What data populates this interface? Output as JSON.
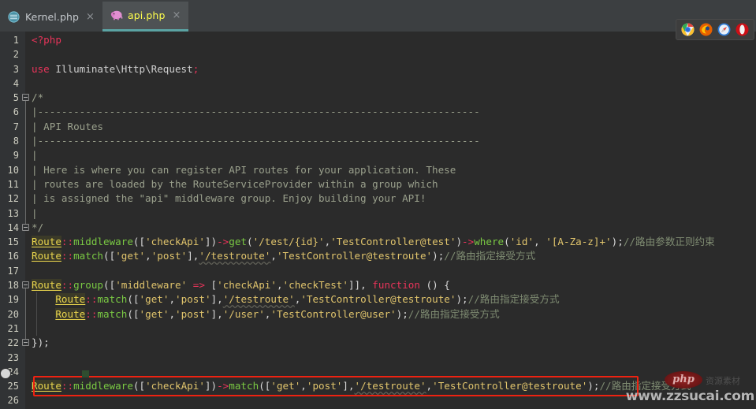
{
  "window": {
    "app": "PhpStorm Editor",
    "background_color": "#2b2b2b"
  },
  "tabs": [
    {
      "label": "Kernel.php",
      "icon": "php-file-icon",
      "close_label": "×",
      "active": false
    },
    {
      "label": "api.php",
      "icon": "php-elephant-icon",
      "close_label": "×",
      "active": true
    }
  ],
  "gutter": {
    "line_numbers": [
      "1",
      "2",
      "3",
      "4",
      "5",
      "6",
      "7",
      "8",
      "9",
      "10",
      "11",
      "12",
      "13",
      "14",
      "15",
      "16",
      "17",
      "18",
      "19",
      "20",
      "21",
      "22",
      "23",
      "24",
      "25",
      "26"
    ]
  },
  "browser_tray": {
    "icons": [
      {
        "name": "chrome-icon",
        "color": "#e8453c"
      },
      {
        "name": "firefox-icon",
        "color": "#e66000"
      },
      {
        "name": "safari-icon",
        "color": "#2f7bd6"
      },
      {
        "name": "opera-icon",
        "color": "#cc0f16"
      }
    ]
  },
  "watermark": {
    "logo_text": "php",
    "url": "www.zzsucai.com",
    "ghost_text": "资源素材"
  },
  "editor": {
    "language": "PHP",
    "highlight": {
      "border_color": "#ee2211",
      "line_number": 25,
      "note": "red rectangle around Route::middleware(['checkApi'])->match(...) statement"
    },
    "lines": [
      {
        "n": 1,
        "tokens": [
          {
            "t": "<?php",
            "c": "kw2"
          }
        ]
      },
      {
        "n": 2,
        "tokens": []
      },
      {
        "n": 3,
        "tokens": [
          {
            "t": "use",
            "c": "kw2"
          },
          {
            "t": " Illuminate\\Http\\Request",
            "c": "plain"
          },
          {
            "t": ";",
            "c": "kw2"
          }
        ]
      },
      {
        "n": 4,
        "tokens": []
      },
      {
        "n": 5,
        "tokens": [
          {
            "t": "/*",
            "c": "doc"
          }
        ]
      },
      {
        "n": 6,
        "tokens": [
          {
            "t": "|--------------------------------------------------------------------------",
            "c": "doc"
          }
        ]
      },
      {
        "n": 7,
        "tokens": [
          {
            "t": "| API Routes",
            "c": "doc"
          }
        ]
      },
      {
        "n": 8,
        "tokens": [
          {
            "t": "|--------------------------------------------------------------------------",
            "c": "doc"
          }
        ]
      },
      {
        "n": 9,
        "tokens": [
          {
            "t": "|",
            "c": "doc"
          }
        ]
      },
      {
        "n": 10,
        "tokens": [
          {
            "t": "| Here is where you can register API routes for your application. These",
            "c": "doc"
          }
        ]
      },
      {
        "n": 11,
        "tokens": [
          {
            "t": "| routes are loaded by the RouteServiceProvider within a group which",
            "c": "doc"
          }
        ]
      },
      {
        "n": 12,
        "tokens": [
          {
            "t": "| is assigned the \"api\" middleware group. Enjoy building your API!",
            "c": "doc"
          }
        ]
      },
      {
        "n": 13,
        "tokens": [
          {
            "t": "|",
            "c": "doc"
          }
        ]
      },
      {
        "n": 14,
        "tokens": [
          {
            "t": "*/",
            "c": "doc"
          }
        ]
      },
      {
        "n": 15,
        "tokens": [
          {
            "t": "Route",
            "c": "cls"
          },
          {
            "t": "::",
            "c": "colon"
          },
          {
            "t": "middleware",
            "c": "fn"
          },
          {
            "t": "([",
            "c": "punc"
          },
          {
            "t": "'checkApi'",
            "c": "str"
          },
          {
            "t": "])",
            "c": "punc"
          },
          {
            "t": "->",
            "c": "arrow"
          },
          {
            "t": "get",
            "c": "fn"
          },
          {
            "t": "(",
            "c": "punc"
          },
          {
            "t": "'/test/{id}'",
            "c": "str"
          },
          {
            "t": ",",
            "c": "punc"
          },
          {
            "t": "'TestController@test'",
            "c": "str"
          },
          {
            "t": ")",
            "c": "punc"
          },
          {
            "t": "->",
            "c": "arrow"
          },
          {
            "t": "where",
            "c": "fn"
          },
          {
            "t": "(",
            "c": "punc"
          },
          {
            "t": "'id'",
            "c": "str"
          },
          {
            "t": ", ",
            "c": "punc"
          },
          {
            "t": "'[A-Za-z]+'",
            "c": "str"
          },
          {
            "t": ");",
            "c": "punc"
          },
          {
            "t": "//路由参数正则约束",
            "c": "cmt"
          }
        ]
      },
      {
        "n": 16,
        "tokens": [
          {
            "t": "Route",
            "c": "cls"
          },
          {
            "t": "::",
            "c": "colon"
          },
          {
            "t": "match",
            "c": "fn"
          },
          {
            "t": "([",
            "c": "punc"
          },
          {
            "t": "'get'",
            "c": "str"
          },
          {
            "t": ",",
            "c": "punc"
          },
          {
            "t": "'post'",
            "c": "str"
          },
          {
            "t": "],",
            "c": "punc"
          },
          {
            "t": "'/testroute'",
            "c": "str-u"
          },
          {
            "t": ",",
            "c": "punc"
          },
          {
            "t": "'TestController@testroute'",
            "c": "str"
          },
          {
            "t": ");",
            "c": "punc"
          },
          {
            "t": "//路由指定接受方式",
            "c": "cmt"
          }
        ]
      },
      {
        "n": 17,
        "tokens": []
      },
      {
        "n": 18,
        "tokens": [
          {
            "t": "Route",
            "c": "cls"
          },
          {
            "t": "::",
            "c": "colon"
          },
          {
            "t": "group",
            "c": "fn"
          },
          {
            "t": "([",
            "c": "punc"
          },
          {
            "t": "'middleware'",
            "c": "str"
          },
          {
            "t": " ",
            "c": "punc"
          },
          {
            "t": "=>",
            "c": "op"
          },
          {
            "t": " [",
            "c": "punc"
          },
          {
            "t": "'checkApi'",
            "c": "str"
          },
          {
            "t": ",",
            "c": "punc"
          },
          {
            "t": "'checkTest'",
            "c": "str"
          },
          {
            "t": "]], ",
            "c": "punc"
          },
          {
            "t": "function",
            "c": "fnkw"
          },
          {
            "t": " () {",
            "c": "punc"
          }
        ]
      },
      {
        "n": 19,
        "tokens": [
          {
            "t": "    ",
            "c": "punc"
          },
          {
            "t": "Route",
            "c": "cls"
          },
          {
            "t": "::",
            "c": "colon"
          },
          {
            "t": "match",
            "c": "fn"
          },
          {
            "t": "([",
            "c": "punc"
          },
          {
            "t": "'get'",
            "c": "str"
          },
          {
            "t": ",",
            "c": "punc"
          },
          {
            "t": "'post'",
            "c": "str"
          },
          {
            "t": "],",
            "c": "punc"
          },
          {
            "t": "'/testroute'",
            "c": "str-u"
          },
          {
            "t": ",",
            "c": "punc"
          },
          {
            "t": "'TestController@testroute'",
            "c": "str"
          },
          {
            "t": ");",
            "c": "punc"
          },
          {
            "t": "//路由指定接受方式",
            "c": "cmt"
          }
        ]
      },
      {
        "n": 20,
        "tokens": [
          {
            "t": "    ",
            "c": "punc"
          },
          {
            "t": "Route",
            "c": "cls"
          },
          {
            "t": "::",
            "c": "colon"
          },
          {
            "t": "match",
            "c": "fn"
          },
          {
            "t": "([",
            "c": "punc"
          },
          {
            "t": "'get'",
            "c": "str"
          },
          {
            "t": ",",
            "c": "punc"
          },
          {
            "t": "'post'",
            "c": "str"
          },
          {
            "t": "],",
            "c": "punc"
          },
          {
            "t": "'/user'",
            "c": "str"
          },
          {
            "t": ",",
            "c": "punc"
          },
          {
            "t": "'TestController@user'",
            "c": "str"
          },
          {
            "t": ");",
            "c": "punc"
          },
          {
            "t": "//路由指定接受方式",
            "c": "cmt"
          }
        ]
      },
      {
        "n": 21,
        "tokens": []
      },
      {
        "n": 22,
        "tokens": [
          {
            "t": "});",
            "c": "punc"
          }
        ]
      },
      {
        "n": 23,
        "tokens": []
      },
      {
        "n": 24,
        "tokens": []
      },
      {
        "n": 25,
        "tokens": [
          {
            "t": "Route",
            "c": "cls"
          },
          {
            "t": "::",
            "c": "colon"
          },
          {
            "t": "middleware",
            "c": "fn"
          },
          {
            "t": "([",
            "c": "punc"
          },
          {
            "t": "'checkApi'",
            "c": "str"
          },
          {
            "t": "])",
            "c": "punc"
          },
          {
            "t": "->",
            "c": "arrow"
          },
          {
            "t": "match",
            "c": "fn"
          },
          {
            "t": "([",
            "c": "punc"
          },
          {
            "t": "'get'",
            "c": "str"
          },
          {
            "t": ",",
            "c": "punc"
          },
          {
            "t": "'post'",
            "c": "str"
          },
          {
            "t": "],",
            "c": "punc"
          },
          {
            "t": "'/testroute'",
            "c": "str-u"
          },
          {
            "t": ",",
            "c": "punc"
          },
          {
            "t": "'TestController@testroute'",
            "c": "str"
          },
          {
            "t": ");",
            "c": "punc"
          },
          {
            "t": "//路由指定接受方式",
            "c": "cmt"
          }
        ]
      },
      {
        "n": 26,
        "tokens": []
      }
    ]
  }
}
